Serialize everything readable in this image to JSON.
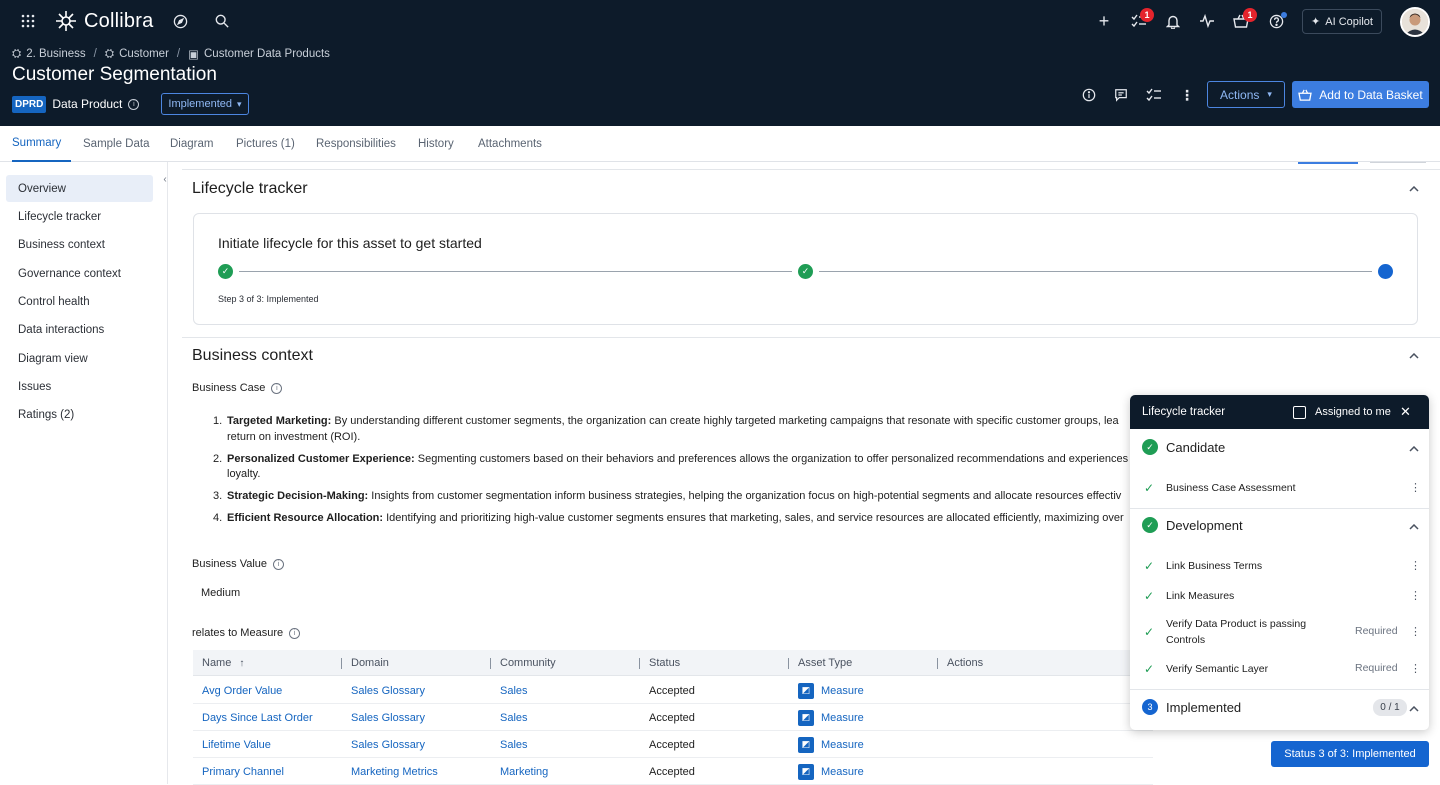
{
  "app": {
    "brand": "Collibra",
    "copilot_label": "AI Copilot",
    "tasks_badge": "1",
    "basket_badge": "1"
  },
  "breadcrumb": [
    "2. Business",
    "Customer",
    "Customer Data Products"
  ],
  "asset": {
    "title": "Customer Segmentation",
    "type_code": "DPRD",
    "type_label": "Data Product",
    "status": "Implemented"
  },
  "header_actions": {
    "actions_label": "Actions",
    "basket_label": "Add to Data Basket"
  },
  "tabs": [
    "Summary",
    "Sample Data",
    "Diagram",
    "Pictures (1)",
    "Responsibilities",
    "History",
    "Attachments"
  ],
  "sidenav": [
    "Overview",
    "Lifecycle tracker",
    "Business context",
    "Governance context",
    "Control health",
    "Data interactions",
    "Diagram view",
    "Issues",
    "Ratings (2)"
  ],
  "lifecycle": {
    "heading": "Lifecycle tracker",
    "card_title": "Initiate lifecycle for this asset to get started",
    "step_text": "Step 3 of 3: Implemented"
  },
  "business_context": {
    "heading": "Business context",
    "case_label": "Business Case",
    "case_items": [
      {
        "num": "1.",
        "title": "Targeted Marketing:",
        "text": " By understanding different customer segments, the organization can create highly targeted marketing campaigns that resonate with specific customer groups, lea",
        "cont": "return on investment (ROI)."
      },
      {
        "num": "2.",
        "title": "Personalized Customer Experience:",
        "text": " Segmenting customers based on their behaviors and preferences allows the organization to offer personalized recommendations and experiences",
        "cont": "loyalty."
      },
      {
        "num": "3.",
        "title": "Strategic Decision-Making:",
        "text": " Insights from customer segmentation inform business strategies, helping the organization focus on high-potential segments and allocate resources effectiv",
        "cont": ""
      },
      {
        "num": "4.",
        "title": "Efficient Resource Allocation:",
        "text": " Identifying and prioritizing high-value customer segments ensures that marketing, sales, and service resources are allocated efficiently, maximizing over",
        "cont": ""
      }
    ],
    "value_label": "Business Value",
    "value": "Medium",
    "relation_label": "relates to Measure"
  },
  "table": {
    "columns": [
      "Name",
      "Domain",
      "Community",
      "Status",
      "Asset Type",
      "Actions"
    ],
    "sort_indicator": "↑",
    "rows": [
      {
        "name": "Avg Order Value",
        "domain": "Sales Glossary",
        "community": "Sales",
        "status": "Accepted",
        "asset_type": "Measure"
      },
      {
        "name": "Days Since Last Order",
        "domain": "Sales Glossary",
        "community": "Sales",
        "status": "Accepted",
        "asset_type": "Measure"
      },
      {
        "name": "Lifetime Value",
        "domain": "Sales Glossary",
        "community": "Sales",
        "status": "Accepted",
        "asset_type": "Measure"
      },
      {
        "name": "Primary Channel",
        "domain": "Marketing Metrics",
        "community": "Marketing",
        "status": "Accepted",
        "asset_type": "Measure"
      }
    ]
  },
  "panel": {
    "title": "Lifecycle tracker",
    "assigned_label": "Assigned to me",
    "stages": [
      {
        "name": "Candidate",
        "items": [
          {
            "label": "Business Case Assessment",
            "req": ""
          }
        ]
      },
      {
        "name": "Development",
        "items": [
          {
            "label": "Link Business Terms",
            "req": ""
          },
          {
            "label": "Link Measures",
            "req": ""
          },
          {
            "label": "Verify Data Product is passing Controls",
            "req": "Required"
          },
          {
            "label": "Verify Semantic Layer",
            "req": "Required"
          }
        ]
      },
      {
        "name": "Implemented",
        "num": "3",
        "count": "0 / 1"
      }
    ]
  },
  "status_button": "Status 3 of 3: Implemented",
  "colors": {
    "header_bg": "#0d1b2a",
    "accent": "#1565c0",
    "success": "#1f9d55"
  }
}
